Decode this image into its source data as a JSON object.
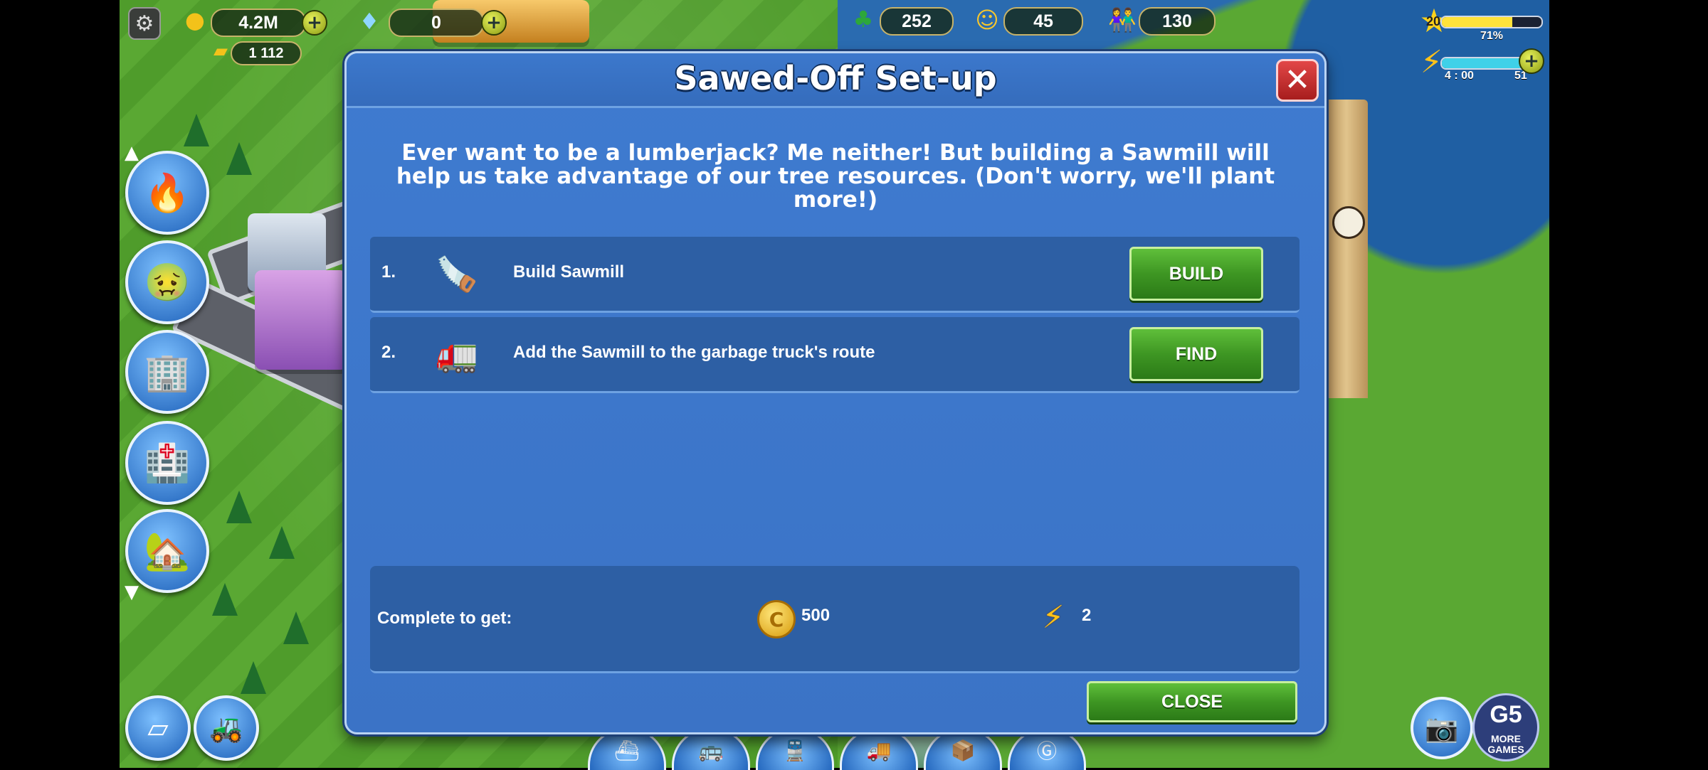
{
  "hud": {
    "coins": "4.2M",
    "gems": "0",
    "gold_bars": "1 112",
    "trees": "252",
    "happiness": "45",
    "population": "130",
    "level": "20",
    "xp_percent_label": "71%",
    "xp_fraction": 0.71,
    "energy_timer": "4 : 00",
    "energy": "51",
    "energy_fraction": 0.85
  },
  "icons": {
    "settings": "gear-icon",
    "coin": "coin-stack-icon",
    "gem": "diamond-icon",
    "gold": "gold-bar-icon",
    "tree": "tree-icon",
    "happy": "smiley-icon",
    "people": "people-icon",
    "star": "star-icon",
    "bolt": "lightning-icon"
  },
  "modal": {
    "title": "Sawed-Off Set-up",
    "intro": "Ever want to be a lumberjack? Me neither! But building a Sawmill will help us take advantage of our tree resources. (Don't worry, we'll plant more!)",
    "tasks": [
      {
        "num": "1.",
        "text": "Build Sawmill",
        "button": "BUILD"
      },
      {
        "num": "2.",
        "text": "Add the Sawmill to the garbage truck's route",
        "button": "FIND"
      }
    ],
    "reward_label": "Complete to get:",
    "reward_coins": "500",
    "reward_energy": "2",
    "close_label": "CLOSE"
  },
  "corner": {
    "g5_logo": "G5",
    "more_games": "MORE\nGAMES"
  },
  "colors": {
    "modal_bg": "#3b73c6",
    "row_bg": "#2d5fa4",
    "button_green": "#3e9623",
    "close_red": "#c62f2f"
  }
}
